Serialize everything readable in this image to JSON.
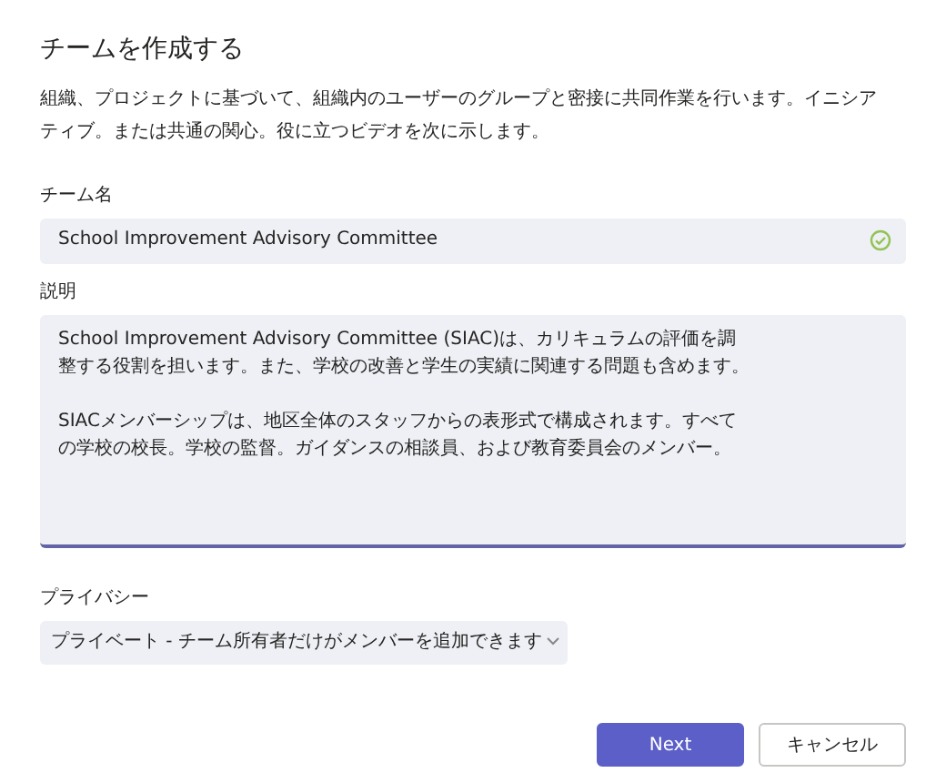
{
  "dialog": {
    "title": "チームを作成する",
    "intro": "組織、プロジェクトに基づいて、組織内のユーザーのグループと密接に共同作業を行います。イニシアティブ。または共通の関心。役に立つビデオを次に示します。"
  },
  "team_name": {
    "label": "チーム名",
    "value": "School Improvement Advisory Committee",
    "valid": true
  },
  "description": {
    "label": "説明",
    "paragraphs": [
      "School Improvement Advisory Committee (SIAC)は、カリキュラムの評価を調整する役割を担います。また、学校の改善と学生の実績に関連する問題も含めます。",
      "SIACメンバーシップは、地区全体のスタッフからの表形式で構成されます。すべての学校の校長。学校の監督。ガイダンスの相談員、および教育委員会のメンバー。"
    ],
    "focused": true
  },
  "privacy": {
    "label": "プライバシー",
    "value": "プライベート - チーム所有者だけがメンバーを追加できます"
  },
  "buttons": [
    {
      "label": "Next",
      "kind": "primary"
    },
    {
      "label": "キャンセル",
      "kind": "secondary"
    }
  ]
}
